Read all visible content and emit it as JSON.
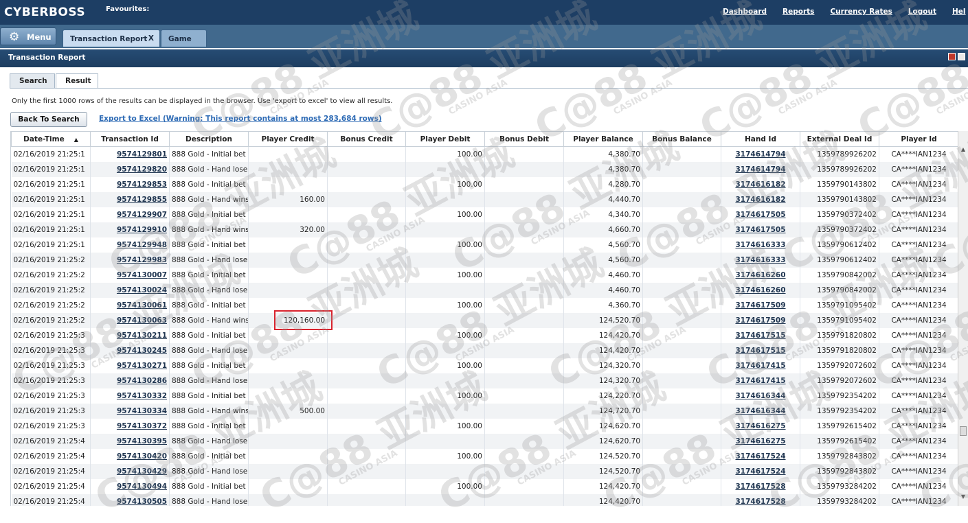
{
  "app": {
    "brand": "CYBERBOSS",
    "favourites_label": "Favourites:",
    "nav_links": [
      "Dashboard",
      "Reports",
      "Currency Rates",
      "Logout",
      "Hel"
    ]
  },
  "tabbar": {
    "menu_label": "Menu",
    "tabs": [
      {
        "label": "Transaction Report",
        "close": "X"
      },
      {
        "label": "Game"
      }
    ]
  },
  "panel": {
    "title": "Transaction Report",
    "subtabs": [
      "Search",
      "Result"
    ],
    "notice": "Only the first 1000 rows of the results can be displayed in the browser.  Use 'export to excel' to view all results.",
    "back_button": "Back To Search",
    "export_link": "Export to Excel (Warning: This report contains at most 283,684 rows)"
  },
  "table": {
    "columns": [
      "Date-Time",
      "Transaction Id",
      "Description",
      "Player Credit",
      "Bonus Credit",
      "Player Debit",
      "Bonus Debit",
      "Player Balance",
      "Bonus Balance",
      "Hand Id",
      "External Deal Id",
      "Player Id"
    ],
    "sort_indicator": "▲",
    "rows": [
      [
        "02/16/2019 21:25:1",
        "9574129801",
        "888 Gold - Initial bet",
        "",
        "",
        "100.00",
        "",
        "4,380.70",
        "",
        "3174614794",
        "1359789926202",
        "CA****IAN1234"
      ],
      [
        "02/16/2019 21:25:1",
        "9574129820",
        "888 Gold - Hand lose",
        "",
        "",
        "",
        "",
        "4,380.70",
        "",
        "3174614794",
        "1359789926202",
        "CA****IAN1234"
      ],
      [
        "02/16/2019 21:25:1",
        "9574129853",
        "888 Gold - Initial bet",
        "",
        "",
        "100.00",
        "",
        "4,280.70",
        "",
        "3174616182",
        "1359790143802",
        "CA****IAN1234"
      ],
      [
        "02/16/2019 21:25:1",
        "9574129855",
        "888 Gold - Hand wins",
        "160.00",
        "",
        "",
        "",
        "4,440.70",
        "",
        "3174616182",
        "1359790143802",
        "CA****IAN1234"
      ],
      [
        "02/16/2019 21:25:1",
        "9574129907",
        "888 Gold - Initial bet",
        "",
        "",
        "100.00",
        "",
        "4,340.70",
        "",
        "3174617505",
        "1359790372402",
        "CA****IAN1234"
      ],
      [
        "02/16/2019 21:25:1",
        "9574129910",
        "888 Gold - Hand wins",
        "320.00",
        "",
        "",
        "",
        "4,660.70",
        "",
        "3174617505",
        "1359790372402",
        "CA****IAN1234"
      ],
      [
        "02/16/2019 21:25:1",
        "9574129948",
        "888 Gold - Initial bet",
        "",
        "",
        "100.00",
        "",
        "4,560.70",
        "",
        "3174616333",
        "1359790612402",
        "CA****IAN1234"
      ],
      [
        "02/16/2019 21:25:2",
        "9574129983",
        "888 Gold - Hand lose",
        "",
        "",
        "",
        "",
        "4,560.70",
        "",
        "3174616333",
        "1359790612402",
        "CA****IAN1234"
      ],
      [
        "02/16/2019 21:25:2",
        "9574130007",
        "888 Gold - Initial bet",
        "",
        "",
        "100.00",
        "",
        "4,460.70",
        "",
        "3174616260",
        "1359790842002",
        "CA****IAN1234"
      ],
      [
        "02/16/2019 21:25:2",
        "9574130024",
        "888 Gold - Hand lose",
        "",
        "",
        "",
        "",
        "4,460.70",
        "",
        "3174616260",
        "1359790842002",
        "CA****IAN1234"
      ],
      [
        "02/16/2019 21:25:2",
        "9574130061",
        "888 Gold - Initial bet",
        "",
        "",
        "100.00",
        "",
        "4,360.70",
        "",
        "3174617509",
        "1359791095402",
        "CA****IAN1234"
      ],
      [
        "02/16/2019 21:25:2",
        "9574130063",
        "888 Gold - Hand wins",
        "120,160.00",
        "",
        "",
        "",
        "124,520.70",
        "",
        "3174617509",
        "1359791095402",
        "CA****IAN1234"
      ],
      [
        "02/16/2019 21:25:3",
        "9574130211",
        "888 Gold - Initial bet",
        "",
        "",
        "100.00",
        "",
        "124,420.70",
        "",
        "3174617515",
        "1359791820802",
        "CA****IAN1234"
      ],
      [
        "02/16/2019 21:25:3",
        "9574130245",
        "888 Gold - Hand lose",
        "",
        "",
        "",
        "",
        "124,420.70",
        "",
        "3174617515",
        "1359791820802",
        "CA****IAN1234"
      ],
      [
        "02/16/2019 21:25:3",
        "9574130271",
        "888 Gold - Initial bet",
        "",
        "",
        "100.00",
        "",
        "124,320.70",
        "",
        "3174617415",
        "1359792072602",
        "CA****IAN1234"
      ],
      [
        "02/16/2019 21:25:3",
        "9574130286",
        "888 Gold - Hand lose",
        "",
        "",
        "",
        "",
        "124,320.70",
        "",
        "3174617415",
        "1359792072602",
        "CA****IAN1234"
      ],
      [
        "02/16/2019 21:25:3",
        "9574130332",
        "888 Gold - Initial bet",
        "",
        "",
        "100.00",
        "",
        "124,220.70",
        "",
        "3174616344",
        "1359792354202",
        "CA****IAN1234"
      ],
      [
        "02/16/2019 21:25:3",
        "9574130334",
        "888 Gold - Hand wins",
        "500.00",
        "",
        "",
        "",
        "124,720.70",
        "",
        "3174616344",
        "1359792354202",
        "CA****IAN1234"
      ],
      [
        "02/16/2019 21:25:3",
        "9574130372",
        "888 Gold - Initial bet",
        "",
        "",
        "100.00",
        "",
        "124,620.70",
        "",
        "3174616275",
        "1359792615402",
        "CA****IAN1234"
      ],
      [
        "02/16/2019 21:25:4",
        "9574130395",
        "888 Gold - Hand lose",
        "",
        "",
        "",
        "",
        "124,620.70",
        "",
        "3174616275",
        "1359792615402",
        "CA****IAN1234"
      ],
      [
        "02/16/2019 21:25:4",
        "9574130420",
        "888 Gold - Initial bet",
        "",
        "",
        "100.00",
        "",
        "124,520.70",
        "",
        "3174617524",
        "1359792843802",
        "CA****IAN1234"
      ],
      [
        "02/16/2019 21:25:4",
        "9574130429",
        "888 Gold - Hand lose",
        "",
        "",
        "",
        "",
        "124,520.70",
        "",
        "3174617524",
        "1359792843802",
        "CA****IAN1234"
      ],
      [
        "02/16/2019 21:25:4",
        "9574130494",
        "888 Gold - Initial bet",
        "",
        "",
        "100.00",
        "",
        "124,420.70",
        "",
        "3174617528",
        "1359793284202",
        "CA****IAN1234"
      ],
      [
        "02/16/2019 21:25:4",
        "9574130505",
        "888 Gold - Hand lose",
        "",
        "",
        "",
        "",
        "124,420.70",
        "",
        "3174617528",
        "1359793284202",
        "CA****IAN1234"
      ]
    ]
  },
  "watermark": {
    "logo": "C@88 亚洲城",
    "sub": "CASINO ASIA"
  },
  "colors": {
    "header_navy": "#1d3e64",
    "tabbar_blue": "#41698d",
    "highlight_red": "#d9232d",
    "link_blue": "#2e6bb5"
  }
}
